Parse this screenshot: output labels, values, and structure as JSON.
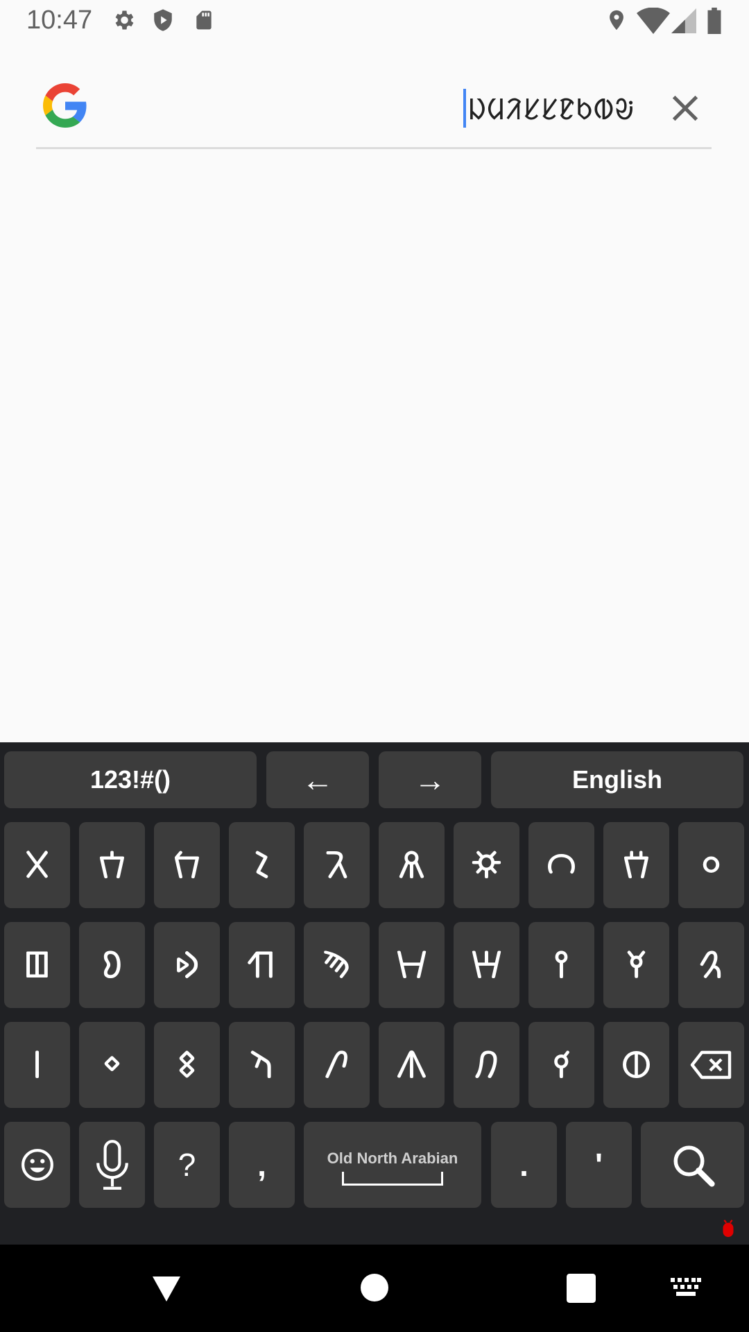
{
  "status_bar": {
    "time": "10:47",
    "left_icons": [
      "gear-icon",
      "shield-icon",
      "sd-card-icon"
    ],
    "right_icons": [
      "location-icon",
      "wifi-icon",
      "signal-icon",
      "battery-icon"
    ]
  },
  "search": {
    "logo": "google-g-logo",
    "query": "ᱡᱢᱤᱥᱥᱱᱠᱵᱶ",
    "clear_icon": "close-icon",
    "colors": {
      "caret": "#4285f4",
      "underline": "#dcdcdc"
    }
  },
  "keyboard": {
    "top_row": {
      "symbols_label": "123!#()",
      "left_arrow": "←",
      "right_arrow": "→",
      "language_label": "English"
    },
    "row1": [
      "𐪉",
      "𐪊",
      "𐪋",
      "𐪌",
      "𐪍",
      "𐪎",
      "𐪏",
      "𐪐",
      "𐪑",
      "𐪒"
    ],
    "row2": [
      "𐪓",
      "𐪔",
      "𐪕",
      "𐪖",
      "𐪗",
      "𐪘",
      "𐪙",
      "𐪚",
      "𐪛",
      "𐪜"
    ],
    "row3": [
      "𐪝",
      "𐪞",
      "𐪟",
      "𐪀",
      "𐪁",
      "𐪂",
      "𐪃",
      "𐪄",
      "𐪅"
    ],
    "bottom_row": {
      "question": "?",
      "comma": ",",
      "space_label": "Old North Arabian",
      "period": ".",
      "apostrophe": "'"
    },
    "icons": [
      "backspace-icon",
      "emoji-icon",
      "microphone-icon",
      "search-icon"
    ],
    "colors": {
      "background": "#202124",
      "key": "#3c3c3c"
    }
  },
  "nav_bar": {
    "icons": [
      "back-icon",
      "home-icon",
      "recents-icon",
      "keyboard-switch-icon"
    ]
  }
}
